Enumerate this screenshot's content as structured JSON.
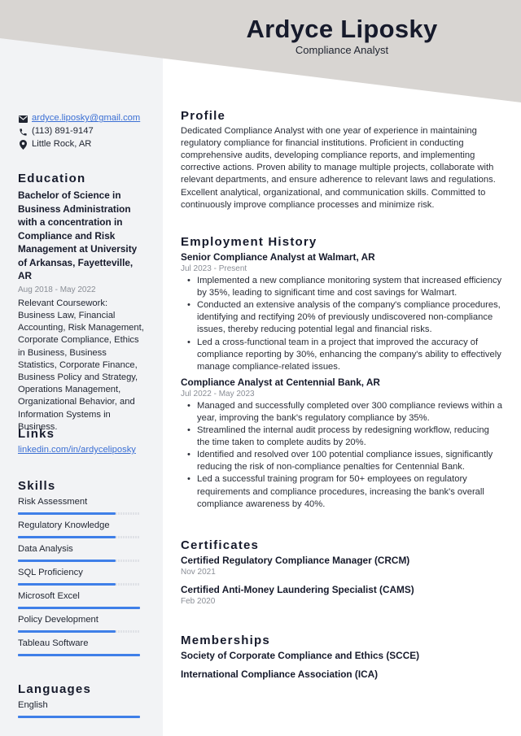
{
  "header": {
    "name": "Ardyce Liposky",
    "title": "Compliance Analyst"
  },
  "colors": {
    "accent": "#3f7fe8",
    "header_band": "#d8d5d2",
    "sidebar_bg": "#f2f3f5",
    "link": "#3b6fd4"
  },
  "contact": {
    "email": "ardyce.liposky@gmail.com",
    "phone": "(113) 891-9147",
    "location": "Little Rock, AR",
    "icons": [
      "envelope-icon",
      "phone-icon",
      "map-pin-icon"
    ]
  },
  "education": {
    "heading": "Education",
    "degree": "Bachelor of Science in Business Administration with a concentration in Compliance and Risk Management at University of Arkansas, Fayetteville, AR",
    "dates": "Aug 2018 - May 2022",
    "description": "Relevant Coursework: Business Law, Financial Accounting, Risk Management, Corporate Compliance, Ethics in Business, Business Statistics, Corporate Finance, Business Policy and Strategy, Operations Management, Organizational Behavior, and Information Systems in Business."
  },
  "links": {
    "heading": "Links",
    "items": [
      "linkedin.com/in/ardyceliposky"
    ]
  },
  "skills": {
    "heading": "Skills",
    "items": [
      {
        "name": "Risk Assessment",
        "level": 0.8
      },
      {
        "name": "Regulatory Knowledge",
        "level": 0.8
      },
      {
        "name": "Data Analysis",
        "level": 0.8
      },
      {
        "name": "SQL Proficiency",
        "level": 0.8
      },
      {
        "name": "Microsoft Excel",
        "level": 1.0
      },
      {
        "name": "Policy Development",
        "level": 0.8
      },
      {
        "name": "Tableau Software",
        "level": 1.0
      }
    ]
  },
  "languages": {
    "heading": "Languages",
    "items": [
      {
        "name": "English",
        "level": 1.0
      }
    ]
  },
  "profile": {
    "heading": "Profile",
    "text": "Dedicated Compliance Analyst with one year of experience in maintaining regulatory compliance for financial institutions. Proficient in conducting comprehensive audits, developing compliance reports, and implementing corrective actions. Proven ability to manage multiple projects, collaborate with relevant departments, and ensure adherence to relevant laws and regulations. Excellent analytical, organizational, and communication skills. Committed to continuously improve compliance processes and minimize risk."
  },
  "employment": {
    "heading": "Employment History",
    "jobs": [
      {
        "title": "Senior Compliance Analyst at Walmart, AR",
        "dates": "Jul 2023 - Present",
        "bullets": [
          "Implemented a new compliance monitoring system that increased efficiency by 35%, leading to significant time and cost savings for Walmart.",
          "Conducted an extensive analysis of the company's compliance procedures, identifying and rectifying 20% of previously undiscovered non-compliance issues, thereby reducing potential legal and financial risks.",
          "Led a cross-functional team in a project that improved the accuracy of compliance reporting by 30%, enhancing the company's ability to effectively manage compliance-related issues."
        ]
      },
      {
        "title": "Compliance Analyst at Centennial Bank, AR",
        "dates": "Jul 2022 - May 2023",
        "bullets": [
          "Managed and successfully completed over 300 compliance reviews within a year, improving the bank's regulatory compliance by 35%.",
          "Streamlined the internal audit process by redesigning workflow, reducing the time taken to complete audits by 20%.",
          "Identified and resolved over 100 potential compliance issues, significantly reducing the risk of non-compliance penalties for Centennial Bank.",
          "Led a successful training program for 50+ employees on regulatory requirements and compliance procedures, increasing the bank's overall compliance awareness by 40%."
        ]
      }
    ]
  },
  "certificates": {
    "heading": "Certificates",
    "items": [
      {
        "title": "Certified Regulatory Compliance Manager (CRCM)",
        "date": "Nov 2021"
      },
      {
        "title": "Certified Anti-Money Laundering Specialist (CAMS)",
        "date": "Feb 2020"
      }
    ]
  },
  "memberships": {
    "heading": "Memberships",
    "items": [
      "Society of Corporate Compliance and Ethics (SCCE)",
      "International Compliance Association (ICA)"
    ]
  }
}
